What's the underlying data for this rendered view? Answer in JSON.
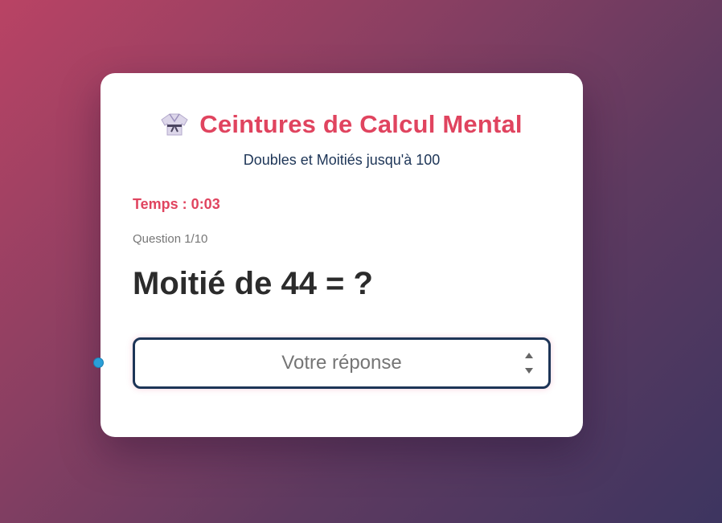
{
  "header": {
    "icon": "karate-gi-icon",
    "title": "Ceintures de Calcul Mental",
    "subtitle": "Doubles et Moitiés jusqu'à 100"
  },
  "quiz": {
    "timer": "Temps : 0:03",
    "counter": "Question 1/10",
    "question": "Moitié de 44 = ?",
    "answer_placeholder": "Votre réponse",
    "answer_value": ""
  },
  "colors": {
    "accent": "#e0445f",
    "navy": "#1d3557",
    "background_start": "#b94364",
    "background_end": "#3d3560"
  }
}
